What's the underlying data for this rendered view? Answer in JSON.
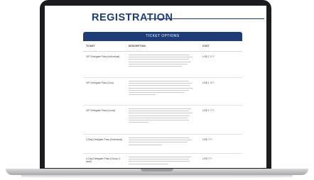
{
  "page": {
    "heading": "REGISTRATION"
  },
  "panel": {
    "title": "TICKET OPTIONS",
    "columns": [
      "TICKET",
      "DESCRIPTION",
      "COST"
    ]
  },
  "rows": [
    {
      "ticket": "VIP Delegate Pass (Individual)",
      "cost": "US$ 2 1??"
    },
    {
      "ticket": "VIP Delegate Pass (Duo)",
      "cost": "US$ 1 9??"
    },
    {
      "ticket": "VIP Delegate Pass (Local)",
      "cost": "US$ 1 7??"
    },
    {
      "ticket": "2-Day Delegate Pass (Individual)",
      "cost": "US$ 7??"
    },
    {
      "ticket": "2-Day Delegate Pass (Group 4 deal)",
      "cost": "US$ 7??"
    }
  ]
}
